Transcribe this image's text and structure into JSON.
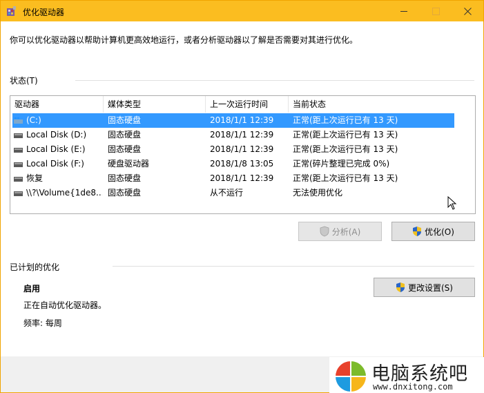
{
  "window": {
    "title": "优化驱动器"
  },
  "intro_text": "你可以优化驱动器以帮助计算机更高效地运行，或者分析驱动器以了解是否需要对其进行优化。",
  "status_section": {
    "label": "状态(T)"
  },
  "table": {
    "columns": [
      "驱动器",
      "媒体类型",
      "上一次运行时间",
      "当前状态"
    ],
    "rows": [
      {
        "drive": "(C:)",
        "media": "固态硬盘",
        "last_run": "2018/1/1 12:39",
        "status": "正常(距上次运行已有 13 天)",
        "selected": true,
        "icon": "windows-drive-icon"
      },
      {
        "drive": "Local Disk (D:)",
        "media": "固态硬盘",
        "last_run": "2018/1/1 12:39",
        "status": "正常(距上次运行已有 13 天)",
        "selected": false,
        "icon": "drive-icon"
      },
      {
        "drive": "Local Disk (E:)",
        "media": "固态硬盘",
        "last_run": "2018/1/1 12:39",
        "status": "正常(距上次运行已有 13 天)",
        "selected": false,
        "icon": "drive-icon"
      },
      {
        "drive": "Local Disk (F:)",
        "media": "硬盘驱动器",
        "last_run": "2018/1/8 13:05",
        "status": "正常(碎片整理已完成 0%)",
        "selected": false,
        "icon": "drive-icon"
      },
      {
        "drive": "恢复",
        "media": "固态硬盘",
        "last_run": "2018/1/1 12:39",
        "status": "正常(距上次运行已有 13 天)",
        "selected": false,
        "icon": "drive-icon"
      },
      {
        "drive": "\\\\?\\Volume{1de8...",
        "media": "固态硬盘",
        "last_run": "从不运行",
        "status": "无法使用优化",
        "selected": false,
        "icon": "drive-icon"
      }
    ]
  },
  "buttons": {
    "analyze": "分析(A)",
    "optimize": "优化(O)",
    "change_settings": "更改设置(S)"
  },
  "scheduled": {
    "label": "已计划的优化",
    "state": "启用",
    "description": "正在自动优化驱动器。",
    "frequency": "频率: 每周"
  },
  "watermark": {
    "title": "电脑系统吧",
    "url": "www.dnxitong.com"
  },
  "colors": {
    "titlebar": "#fbbd20",
    "selection": "#3399ff"
  }
}
